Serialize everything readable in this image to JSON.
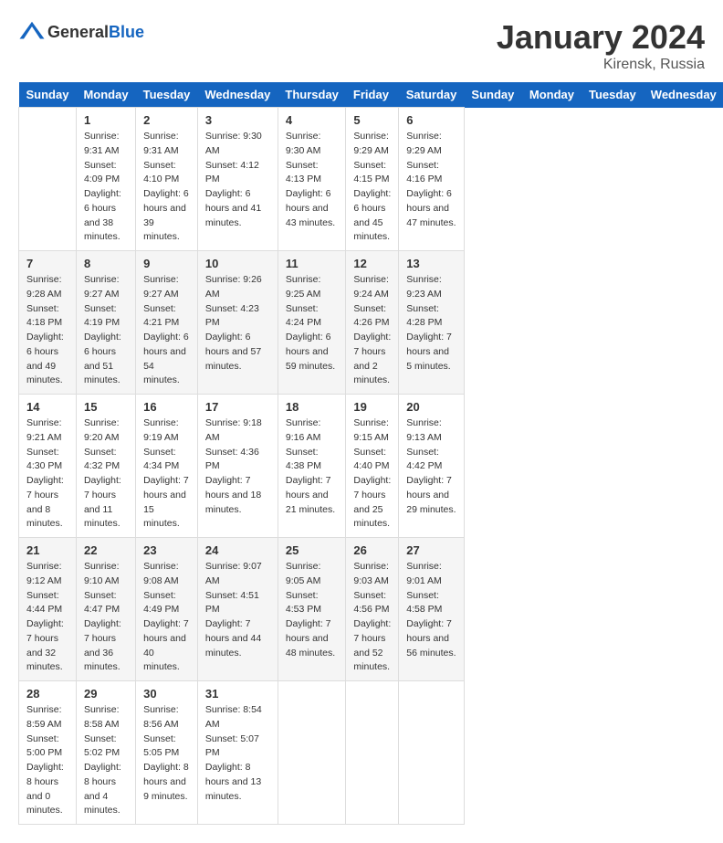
{
  "header": {
    "logo_general": "General",
    "logo_blue": "Blue",
    "month_year": "January 2024",
    "location": "Kirensk, Russia"
  },
  "days_of_week": [
    "Sunday",
    "Monday",
    "Tuesday",
    "Wednesday",
    "Thursday",
    "Friday",
    "Saturday"
  ],
  "weeks": [
    [
      {
        "day": "",
        "sunrise": "",
        "sunset": "",
        "daylight": ""
      },
      {
        "day": "1",
        "sunrise": "Sunrise: 9:31 AM",
        "sunset": "Sunset: 4:09 PM",
        "daylight": "Daylight: 6 hours and 38 minutes."
      },
      {
        "day": "2",
        "sunrise": "Sunrise: 9:31 AM",
        "sunset": "Sunset: 4:10 PM",
        "daylight": "Daylight: 6 hours and 39 minutes."
      },
      {
        "day": "3",
        "sunrise": "Sunrise: 9:30 AM",
        "sunset": "Sunset: 4:12 PM",
        "daylight": "Daylight: 6 hours and 41 minutes."
      },
      {
        "day": "4",
        "sunrise": "Sunrise: 9:30 AM",
        "sunset": "Sunset: 4:13 PM",
        "daylight": "Daylight: 6 hours and 43 minutes."
      },
      {
        "day": "5",
        "sunrise": "Sunrise: 9:29 AM",
        "sunset": "Sunset: 4:15 PM",
        "daylight": "Daylight: 6 hours and 45 minutes."
      },
      {
        "day": "6",
        "sunrise": "Sunrise: 9:29 AM",
        "sunset": "Sunset: 4:16 PM",
        "daylight": "Daylight: 6 hours and 47 minutes."
      }
    ],
    [
      {
        "day": "7",
        "sunrise": "Sunrise: 9:28 AM",
        "sunset": "Sunset: 4:18 PM",
        "daylight": "Daylight: 6 hours and 49 minutes."
      },
      {
        "day": "8",
        "sunrise": "Sunrise: 9:27 AM",
        "sunset": "Sunset: 4:19 PM",
        "daylight": "Daylight: 6 hours and 51 minutes."
      },
      {
        "day": "9",
        "sunrise": "Sunrise: 9:27 AM",
        "sunset": "Sunset: 4:21 PM",
        "daylight": "Daylight: 6 hours and 54 minutes."
      },
      {
        "day": "10",
        "sunrise": "Sunrise: 9:26 AM",
        "sunset": "Sunset: 4:23 PM",
        "daylight": "Daylight: 6 hours and 57 minutes."
      },
      {
        "day": "11",
        "sunrise": "Sunrise: 9:25 AM",
        "sunset": "Sunset: 4:24 PM",
        "daylight": "Daylight: 6 hours and 59 minutes."
      },
      {
        "day": "12",
        "sunrise": "Sunrise: 9:24 AM",
        "sunset": "Sunset: 4:26 PM",
        "daylight": "Daylight: 7 hours and 2 minutes."
      },
      {
        "day": "13",
        "sunrise": "Sunrise: 9:23 AM",
        "sunset": "Sunset: 4:28 PM",
        "daylight": "Daylight: 7 hours and 5 minutes."
      }
    ],
    [
      {
        "day": "14",
        "sunrise": "Sunrise: 9:21 AM",
        "sunset": "Sunset: 4:30 PM",
        "daylight": "Daylight: 7 hours and 8 minutes."
      },
      {
        "day": "15",
        "sunrise": "Sunrise: 9:20 AM",
        "sunset": "Sunset: 4:32 PM",
        "daylight": "Daylight: 7 hours and 11 minutes."
      },
      {
        "day": "16",
        "sunrise": "Sunrise: 9:19 AM",
        "sunset": "Sunset: 4:34 PM",
        "daylight": "Daylight: 7 hours and 15 minutes."
      },
      {
        "day": "17",
        "sunrise": "Sunrise: 9:18 AM",
        "sunset": "Sunset: 4:36 PM",
        "daylight": "Daylight: 7 hours and 18 minutes."
      },
      {
        "day": "18",
        "sunrise": "Sunrise: 9:16 AM",
        "sunset": "Sunset: 4:38 PM",
        "daylight": "Daylight: 7 hours and 21 minutes."
      },
      {
        "day": "19",
        "sunrise": "Sunrise: 9:15 AM",
        "sunset": "Sunset: 4:40 PM",
        "daylight": "Daylight: 7 hours and 25 minutes."
      },
      {
        "day": "20",
        "sunrise": "Sunrise: 9:13 AM",
        "sunset": "Sunset: 4:42 PM",
        "daylight": "Daylight: 7 hours and 29 minutes."
      }
    ],
    [
      {
        "day": "21",
        "sunrise": "Sunrise: 9:12 AM",
        "sunset": "Sunset: 4:44 PM",
        "daylight": "Daylight: 7 hours and 32 minutes."
      },
      {
        "day": "22",
        "sunrise": "Sunrise: 9:10 AM",
        "sunset": "Sunset: 4:47 PM",
        "daylight": "Daylight: 7 hours and 36 minutes."
      },
      {
        "day": "23",
        "sunrise": "Sunrise: 9:08 AM",
        "sunset": "Sunset: 4:49 PM",
        "daylight": "Daylight: 7 hours and 40 minutes."
      },
      {
        "day": "24",
        "sunrise": "Sunrise: 9:07 AM",
        "sunset": "Sunset: 4:51 PM",
        "daylight": "Daylight: 7 hours and 44 minutes."
      },
      {
        "day": "25",
        "sunrise": "Sunrise: 9:05 AM",
        "sunset": "Sunset: 4:53 PM",
        "daylight": "Daylight: 7 hours and 48 minutes."
      },
      {
        "day": "26",
        "sunrise": "Sunrise: 9:03 AM",
        "sunset": "Sunset: 4:56 PM",
        "daylight": "Daylight: 7 hours and 52 minutes."
      },
      {
        "day": "27",
        "sunrise": "Sunrise: 9:01 AM",
        "sunset": "Sunset: 4:58 PM",
        "daylight": "Daylight: 7 hours and 56 minutes."
      }
    ],
    [
      {
        "day": "28",
        "sunrise": "Sunrise: 8:59 AM",
        "sunset": "Sunset: 5:00 PM",
        "daylight": "Daylight: 8 hours and 0 minutes."
      },
      {
        "day": "29",
        "sunrise": "Sunrise: 8:58 AM",
        "sunset": "Sunset: 5:02 PM",
        "daylight": "Daylight: 8 hours and 4 minutes."
      },
      {
        "day": "30",
        "sunrise": "Sunrise: 8:56 AM",
        "sunset": "Sunset: 5:05 PM",
        "daylight": "Daylight: 8 hours and 9 minutes."
      },
      {
        "day": "31",
        "sunrise": "Sunrise: 8:54 AM",
        "sunset": "Sunset: 5:07 PM",
        "daylight": "Daylight: 8 hours and 13 minutes."
      },
      {
        "day": "",
        "sunrise": "",
        "sunset": "",
        "daylight": ""
      },
      {
        "day": "",
        "sunrise": "",
        "sunset": "",
        "daylight": ""
      },
      {
        "day": "",
        "sunrise": "",
        "sunset": "",
        "daylight": ""
      }
    ]
  ]
}
